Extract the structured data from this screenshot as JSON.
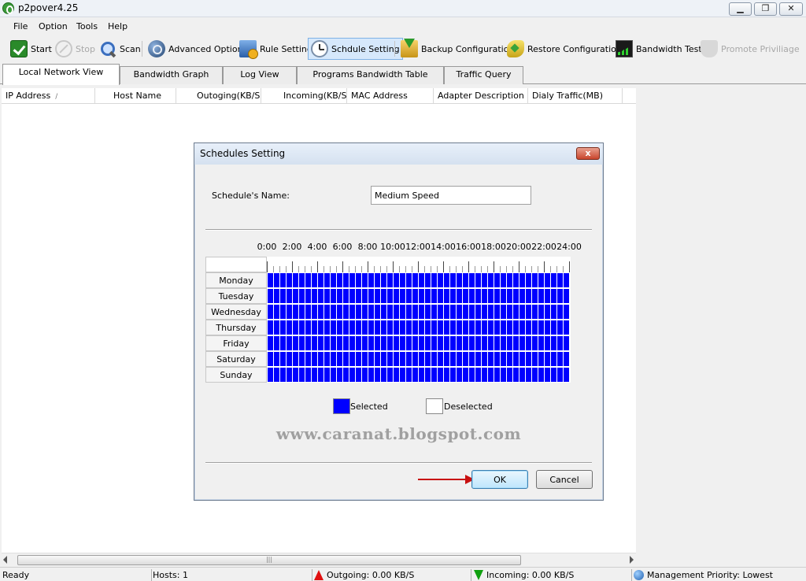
{
  "window": {
    "title": "p2pover4.25"
  },
  "menu": [
    "File",
    "Option",
    "Tools",
    "Help"
  ],
  "toolbar": [
    {
      "label": "Start",
      "icon": "check-icon",
      "state": "enabled"
    },
    {
      "label": "Stop",
      "icon": "stop-icon",
      "state": "disabled"
    },
    {
      "label": "Scan",
      "icon": "magnifier-icon",
      "state": "enabled"
    },
    {
      "label": "Advanced Option",
      "icon": "globe-gear-icon",
      "state": "enabled"
    },
    {
      "label": "Rule Setting",
      "icon": "rule-gear-icon",
      "state": "enabled"
    },
    {
      "label": "Schdule Setting",
      "icon": "clock-icon",
      "state": "active"
    },
    {
      "label": "Backup Configuration",
      "icon": "backup-icon",
      "state": "enabled"
    },
    {
      "label": "Restore Configuration",
      "icon": "restore-icon",
      "state": "enabled"
    },
    {
      "label": "Bandwidth Test",
      "icon": "bandwidth-chart-icon",
      "state": "enabled"
    },
    {
      "label": "Promote Priviliage",
      "icon": "shield-icon",
      "state": "disabled"
    }
  ],
  "tabs": [
    {
      "label": "Local Network View",
      "active": true
    },
    {
      "label": "Bandwidth Graph",
      "active": false
    },
    {
      "label": "Log View",
      "active": false
    },
    {
      "label": "Programs Bandwidth Table",
      "active": false
    },
    {
      "label": "Traffic Query",
      "active": false
    }
  ],
  "columns": [
    "IP Address",
    "Host Name",
    "Outoging(KB/S)",
    "Incoming(KB/S)",
    "MAC Address",
    "Adapter Description",
    "Dialy Traffic(MB)"
  ],
  "sort_indicator": "/",
  "scrollbar": {
    "grip": "|||"
  },
  "status": {
    "ready": "Ready",
    "hosts": "Hosts: 1",
    "outgoing": "Outgoing: 0.00 KB/S",
    "incoming": "Incoming: 0.00 KB/S",
    "priority": "Management Priority: Lowest"
  },
  "dialog": {
    "title": "Schedules Setting",
    "close_label": "x",
    "name_label": "Schedule's Name:",
    "name_value": "Medium Speed",
    "hour_labels": [
      "0:00",
      "2:00",
      "4:00",
      "6:00",
      "8:00",
      "10:00",
      "12:00",
      "14:00",
      "16:00",
      "18:00",
      "20:00",
      "22:00",
      "24:00"
    ],
    "days": [
      "Monday",
      "Tuesday",
      "Wednesday",
      "Thursday",
      "Friday",
      "Saturday",
      "Sunday"
    ],
    "slots_per_day": 48,
    "selected_all": true,
    "legend": {
      "selected": "Selected",
      "deselected": "Deselected"
    },
    "colors": {
      "selected": "#0000ff",
      "deselected": "#ffffff"
    },
    "watermark": "www.caranat.blogspot.com",
    "ok_label": "OK",
    "cancel_label": "Cancel"
  }
}
